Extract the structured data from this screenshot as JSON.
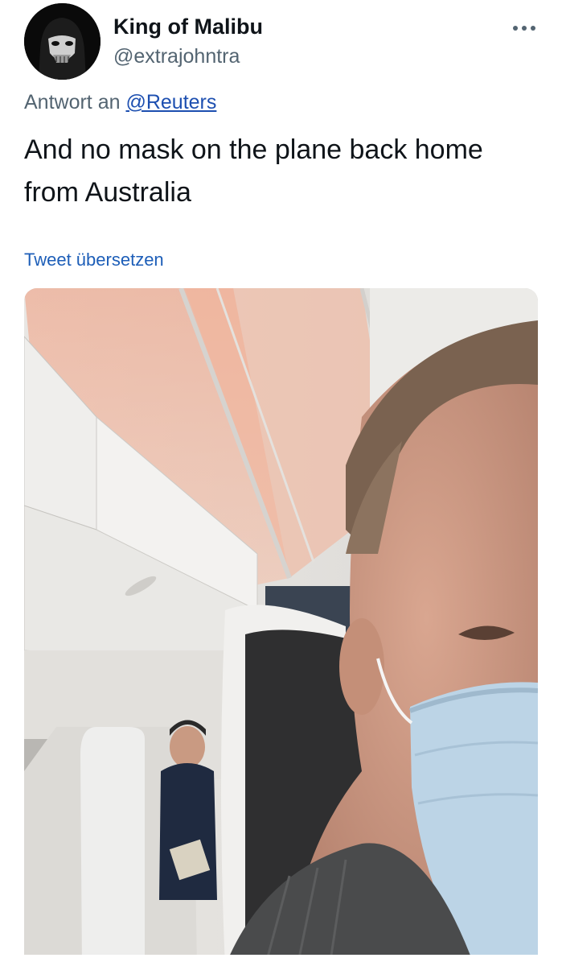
{
  "tweet": {
    "author_name": "King of Malibu",
    "author_handle": "@extrajohntra",
    "reply_prefix": "Antwort an",
    "reply_to": "@Reuters",
    "text": "And no mask on the plane back home from Australia",
    "translate_label": "Tweet übersetzen"
  },
  "icons": {
    "avatar": "masked-figure-avatar",
    "more": "more-dots-icon"
  },
  "colors": {
    "text": "#0f1419",
    "secondary": "#536471",
    "link": "#1d5eb8",
    "background": "#ffffff"
  }
}
